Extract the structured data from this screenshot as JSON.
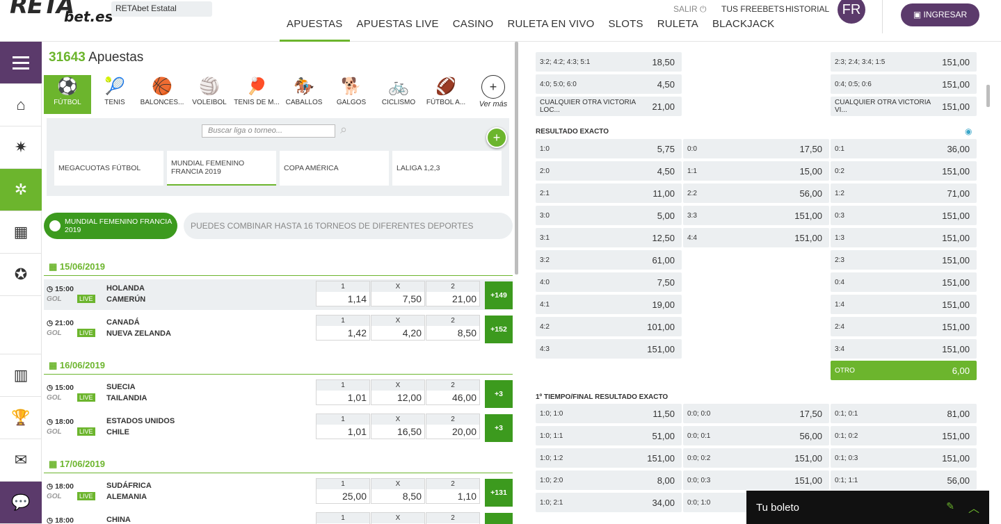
{
  "header": {
    "logo_main": "RETA",
    "logo_sub": "bet.es",
    "estatal": "RETAbet Estatal",
    "nav": [
      "APUESTAS",
      "APUESTAS LIVE",
      "CASINO",
      "RULETA EN VIVO",
      "SLOTS",
      "RULETA",
      "BLACKJACK"
    ],
    "salir": "SALIR",
    "freebets": "TUS FREEBETS",
    "historial": "HISTORIAL",
    "avatar": "FR",
    "ingresar": "INGRESAR"
  },
  "center": {
    "count": "31643",
    "count_label": "Apuestas",
    "sports": [
      {
        "label": "FÚTBOL",
        "icon": "⚽"
      },
      {
        "label": "TENIS",
        "icon": "🎾"
      },
      {
        "label": "BALONCES...",
        "icon": "🏀"
      },
      {
        "label": "VOLEIBOL",
        "icon": "🏐"
      },
      {
        "label": "TENIS DE M...",
        "icon": "🏓"
      },
      {
        "label": "CABALLOS",
        "icon": "🏇"
      },
      {
        "label": "GALGOS",
        "icon": "🐕"
      },
      {
        "label": "CICLISMO",
        "icon": "🚲"
      },
      {
        "label": "FÚTBOL A...",
        "icon": "🏈"
      },
      {
        "label": "Ver más",
        "icon": "+"
      }
    ],
    "search_placeholder": "Buscar liga o torneo...",
    "leagues": [
      "MEGACUOTAS FÚTBOL",
      "MUNDIAL FEMENINO FRANCIA 2019",
      "COPA AMÉRICA",
      "LALIGA 1,2,3"
    ],
    "pill": "MUNDIAL FEMENINO FRANCIA 2019",
    "combine": "PUEDES COMBINAR HASTA 16 TORNEOS DE DIFERENTES DEPORTES",
    "odds_headers": [
      "1",
      "X",
      "2"
    ],
    "dates": [
      "15/06/2019",
      "16/06/2019",
      "17/06/2019"
    ],
    "matches": [
      {
        "time": "15:00",
        "home": "HOLANDA",
        "away": "CAMERÚN",
        "o1": "1,14",
        "ox": "7,50",
        "o2": "21,00",
        "more": "+149"
      },
      {
        "time": "21:00",
        "home": "CANADÁ",
        "away": "NUEVA ZELANDA",
        "o1": "1,42",
        "ox": "4,20",
        "o2": "8,50",
        "more": "+152"
      },
      {
        "time": "15:00",
        "home": "SUECIA",
        "away": "TAILANDIA",
        "o1": "1,01",
        "ox": "12,00",
        "o2": "46,00",
        "more": "+3"
      },
      {
        "time": "18:00",
        "home": "ESTADOS UNIDOS",
        "away": "CHILE",
        "o1": "1,01",
        "ox": "16,50",
        "o2": "20,00",
        "more": "+3"
      },
      {
        "time": "18:00",
        "home": "SUDÁFRICA",
        "away": "ALEMANIA",
        "o1": "25,00",
        "ox": "8,50",
        "o2": "1,10",
        "more": "+131"
      },
      {
        "time": "18:00",
        "home": "CHINA",
        "away": "",
        "o1": "",
        "ox": "",
        "o2": "",
        "more": ""
      }
    ],
    "live": "LIVE",
    "gol": "GOL"
  },
  "right": {
    "top_rows": [
      {
        "l": "3:2; 4:2; 4:3; 5:1",
        "lv": "18,50",
        "r": "2:3; 2:4; 3:4; 1:5",
        "rv": "151,00"
      },
      {
        "l": "4:0; 5:0; 6:0",
        "lv": "4,50",
        "r": "0:4; 0:5; 0:6",
        "rv": "151,00"
      },
      {
        "l": "CUALQUIER OTRA VICTORIA LOC...",
        "lv": "21,00",
        "r": "CUALQUIER OTRA VICTORIA VI...",
        "rv": "151,00"
      }
    ],
    "resultado_title": "RESULTADO EXACTO",
    "home_col": [
      [
        "1:0",
        "5,75"
      ],
      [
        "2:0",
        "4,50"
      ],
      [
        "2:1",
        "11,00"
      ],
      [
        "3:0",
        "5,00"
      ],
      [
        "3:1",
        "12,50"
      ],
      [
        "3:2",
        "61,00"
      ],
      [
        "4:0",
        "7,50"
      ],
      [
        "4:1",
        "19,00"
      ],
      [
        "4:2",
        "101,00"
      ],
      [
        "4:3",
        "151,00"
      ]
    ],
    "draw_col": [
      [
        "0:0",
        "17,50"
      ],
      [
        "1:1",
        "15,00"
      ],
      [
        "2:2",
        "56,00"
      ],
      [
        "3:3",
        "151,00"
      ],
      [
        "4:4",
        "151,00"
      ]
    ],
    "away_col": [
      [
        "0:1",
        "36,00"
      ],
      [
        "0:2",
        "151,00"
      ],
      [
        "1:2",
        "71,00"
      ],
      [
        "0:3",
        "151,00"
      ],
      [
        "1:3",
        "151,00"
      ],
      [
        "2:3",
        "151,00"
      ],
      [
        "0:4",
        "151,00"
      ],
      [
        "1:4",
        "151,00"
      ],
      [
        "2:4",
        "151,00"
      ],
      [
        "3:4",
        "151,00"
      ]
    ],
    "otro": [
      "OTRO",
      "6,00"
    ],
    "ht_title": "1º TIEMPO/FINAL RESULTADO EXACTO",
    "ht_col1": [
      [
        "1:0; 1:0",
        "11,50"
      ],
      [
        "1:0; 1:1",
        "51,00"
      ],
      [
        "1:0; 1:2",
        "151,00"
      ],
      [
        "1:0; 2:0",
        "8,00"
      ],
      [
        "1:0; 2:1",
        "34,00"
      ]
    ],
    "ht_col2": [
      [
        "0:0; 0:0",
        "17,50"
      ],
      [
        "0:0; 0:1",
        "56,00"
      ],
      [
        "0:0; 0:2",
        "151,00"
      ],
      [
        "0:0; 0:3",
        "151,00"
      ],
      [
        "0:0; 1:0",
        ""
      ]
    ],
    "ht_col3": [
      [
        "0:1; 0:1",
        "81,00"
      ],
      [
        "0:1; 0:2",
        "151,00"
      ],
      [
        "0:1; 0:3",
        "151,00"
      ],
      [
        "0:1; 1:1",
        "56,00"
      ]
    ],
    "boleto": "Tu boleto"
  }
}
